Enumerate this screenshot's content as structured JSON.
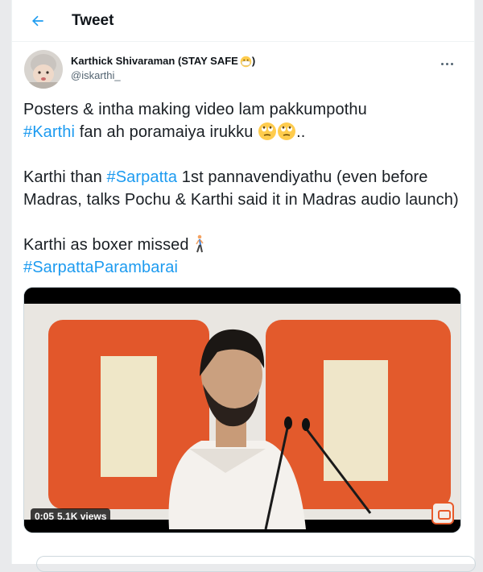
{
  "header": {
    "title": "Tweet",
    "back_icon": "arrow-left-icon",
    "accent": "#1d9bf0"
  },
  "tweet": {
    "author": {
      "display_name": "Karthick Shivaraman (STAY SAFE",
      "name_emoji": "face-with-medical-mask-icon",
      "handle": "@iskarthi_"
    },
    "more_icon": "more-horizontal-icon",
    "body": {
      "p1_line1": "Posters & intha making video lam pakkumpothu",
      "p1_hashtag": "#Karthi",
      "p1_rest": " fan ah poramaiya irukku ",
      "p1_end": "..",
      "p2_pre": "Karthi than ",
      "p2_hashtag": "#Sarpatta",
      "p2_rest": " 1st pannavendiyathu (even before Madras, talks Pochu & Karthi said it in Madras audio launch)",
      "p3_text": "Karthi as boxer missed ",
      "p3_hashtag": "#SarpattaParambarai"
    },
    "media": {
      "type": "video",
      "elapsed": "0:05",
      "views": "5.1K views"
    }
  },
  "colors": {
    "hashtag": "#1d9bf0",
    "secondary_text": "#536471",
    "border": "#eff3f4"
  }
}
